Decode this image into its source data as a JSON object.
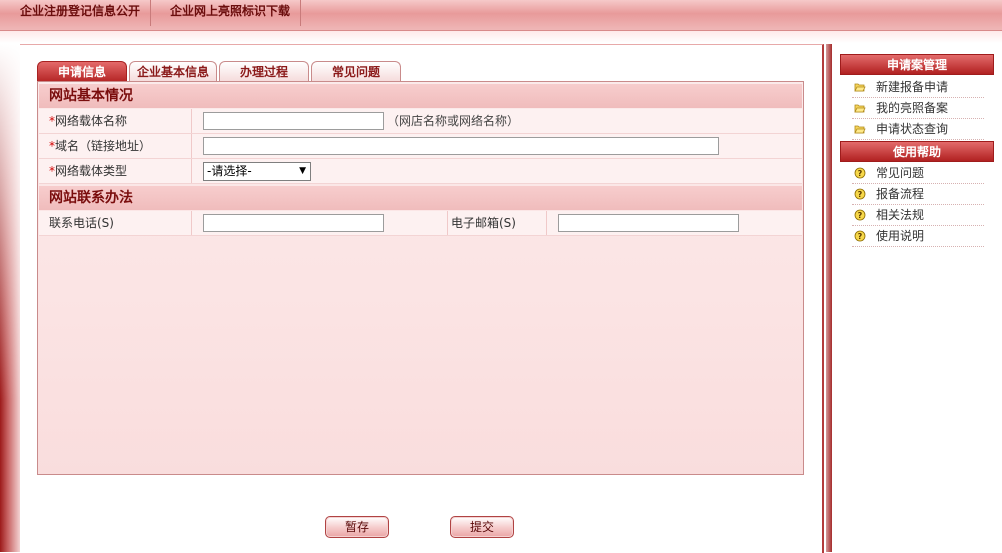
{
  "top_nav": [
    {
      "label": "企业注册登记信息公开"
    },
    {
      "label": "企业网上亮照标识下载"
    }
  ],
  "tabs": [
    {
      "label": "申请信息",
      "active": true
    },
    {
      "label": "企业基本信息",
      "active": false
    },
    {
      "label": "办理过程",
      "active": false
    },
    {
      "label": "常见问题",
      "active": false
    }
  ],
  "form": {
    "section_basic": "网站基本情况",
    "required_mark": "*",
    "carrier_name_label": "网络载体名称",
    "carrier_name_value": "",
    "carrier_name_hint": "（网店名称或网络名称）",
    "domain_label": "域名（链接地址）",
    "domain_value": "",
    "carrier_type_label": "网络载体类型",
    "carrier_type_selected": "-请选择-",
    "section_contact": "网站联系办法",
    "phone_label": "联系电话(S)",
    "phone_value": "",
    "email_label": "电子邮箱(S)",
    "email_value": ""
  },
  "buttons": {
    "save": "暂存",
    "submit": "提交"
  },
  "sidebar": {
    "management_title": "申请案管理",
    "management_items": [
      {
        "label": "新建报备申请",
        "icon": "folder-icon"
      },
      {
        "label": "我的亮照备案",
        "icon": "folder-icon"
      },
      {
        "label": "申请状态查询",
        "icon": "folder-icon"
      }
    ],
    "help_title": "使用帮助",
    "help_items": [
      {
        "label": "常见问题",
        "icon": "help-icon"
      },
      {
        "label": "报备流程",
        "icon": "help-icon"
      },
      {
        "label": "相关法规",
        "icon": "help-icon"
      },
      {
        "label": "使用说明",
        "icon": "help-icon"
      }
    ]
  },
  "colors": {
    "accent": "#b62727",
    "panel_bg": "#fbeaea",
    "section_bg": "#f0bcbc"
  }
}
